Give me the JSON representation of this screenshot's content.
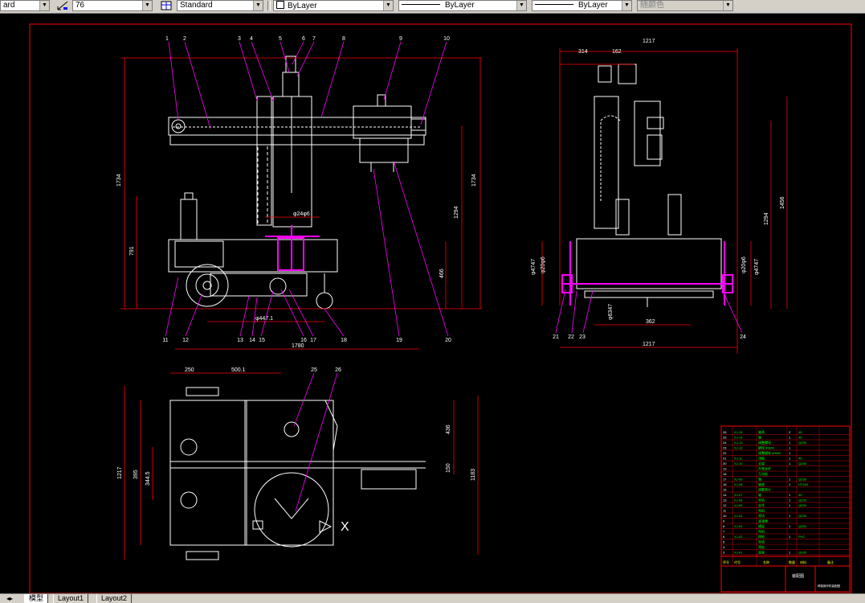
{
  "toolbar": {
    "text_style": "ard",
    "dim_scale": "76",
    "table_style": "Standard",
    "layer_color": "ByLayer",
    "linetype": "ByLayer",
    "lineweight": "ByLayer",
    "plot_style": "随颜色"
  },
  "tabs": {
    "nav": "◂▸",
    "model": "模型",
    "layout1": "Layout1",
    "layout2": "Layout2"
  },
  "colors": {
    "background": "#000000",
    "geometry": "#ffffff",
    "dimension": "#ff0000",
    "leader": "#ff00ff",
    "text_green": "#00ff00"
  },
  "drawing": {
    "front_view": {
      "callouts": [
        "1",
        "2",
        "3",
        "4",
        "5",
        "6",
        "7",
        "8",
        "9",
        "10",
        "11",
        "12",
        "13",
        "14",
        "15",
        "16",
        "17",
        "18",
        "19",
        "20"
      ],
      "dims": {
        "overall_width": "1780",
        "overall_height": "1734",
        "right_height_1": "1734",
        "right_height_2": "1294",
        "left_height": "791",
        "lower_height": "466",
        "diameter_top": "φ24φ6",
        "wheel_base": "φ447.1"
      }
    },
    "side_view": {
      "callouts": [
        "21",
        "22",
        "23",
        "24"
      ],
      "dims": {
        "top_width": "1217",
        "top_left": "314",
        "top_mid": "162",
        "right_height_1": "1456",
        "right_height_2": "1294",
        "left_dia_1": "φ4747",
        "left_dia_2": "φ20φ6",
        "right_dia_1": "φ20φ6",
        "right_dia_2": "φ4747",
        "bottom_mid": "362",
        "bottom_dia": "φ6347",
        "bottom_width": "1217"
      }
    },
    "top_view": {
      "callouts": [
        "25",
        "26"
      ],
      "dims": {
        "top_left": "250",
        "top_mid": "500.1",
        "left_height": "1217",
        "inner_left": "395",
        "inner_left2": "344.5",
        "right_1": "436",
        "right_2": "150",
        "right_3": "1183"
      }
    },
    "title_block": {
      "rows": [
        {
          "no": "26",
          "code": "XJ-15",
          "name": "轴承",
          "qty": "2",
          "mat": "45"
        },
        {
          "no": "25",
          "code": "XJ-14",
          "name": "轴",
          "qty": "1",
          "mat": "45"
        },
        {
          "no": "24",
          "code": "XJ-13",
          "name": "调整螺母",
          "qty": "1",
          "mat": "Q235"
        },
        {
          "no": "23",
          "code": "XJ-12",
          "name": "蜗轮 40MN",
          "qty": "1",
          "mat": ""
        },
        {
          "no": "22",
          "code": "",
          "name": "调整蜗轮 40MN",
          "qty": "1",
          "mat": ""
        },
        {
          "no": "21",
          "code": "XJ-11",
          "name": "顶板",
          "qty": "1",
          "mat": "45"
        },
        {
          "no": "20",
          "code": "XJ-10",
          "name": "支架",
          "qty": "1",
          "mat": "Q235"
        },
        {
          "no": "19",
          "code": "",
          "name": "升降丝杆",
          "qty": "",
          "mat": ""
        },
        {
          "no": "18",
          "code": "",
          "name": "万向轮",
          "qty": "",
          "mat": ""
        },
        {
          "no": "17",
          "code": "XJ-09",
          "name": "轴",
          "qty": "1",
          "mat": "Q235"
        },
        {
          "no": "16",
          "code": "XJ-08",
          "name": "轴座",
          "qty": "1",
          "mat": "HT150"
        },
        {
          "no": "15",
          "code": "",
          "name": "调整垫片",
          "qty": "",
          "mat": ""
        },
        {
          "no": "14",
          "code": "XJ-07",
          "name": "轴",
          "qty": "1",
          "mat": "45"
        },
        {
          "no": "13",
          "code": "XJ-06",
          "name": "导轨",
          "qty": "1",
          "mat": "Q235"
        },
        {
          "no": "12",
          "code": "XJ-05",
          "name": "支柱",
          "qty": "1",
          "mat": "Q235"
        },
        {
          "no": "11",
          "code": "",
          "name": "电机",
          "qty": "",
          "mat": ""
        },
        {
          "no": "10",
          "code": "XJ-04",
          "name": "滑块",
          "qty": "1",
          "mat": "Q235"
        },
        {
          "no": "9",
          "code": "",
          "name": "减速器",
          "qty": "",
          "mat": ""
        },
        {
          "no": "8",
          "code": "XJ-03",
          "name": "横梁",
          "qty": "1",
          "mat": "Q235"
        },
        {
          "no": "7",
          "code": "",
          "name": "电机",
          "qty": "",
          "mat": ""
        },
        {
          "no": "6",
          "code": "XJ-02",
          "name": "焊枪",
          "qty": "1",
          "mat": "PVC"
        },
        {
          "no": "5",
          "code": "",
          "name": "导线",
          "qty": "",
          "mat": ""
        },
        {
          "no": "4",
          "code": "",
          "name": "滑轮",
          "qty": "",
          "mat": ""
        },
        {
          "no": "3",
          "code": "XJ-01",
          "name": "底座",
          "qty": "1",
          "mat": "Q235"
        }
      ],
      "header": {
        "no": "序号",
        "code": "代号",
        "name": "名称",
        "qty": "数量",
        "mat": "材料",
        "note": "备注"
      },
      "title": "装配图",
      "drawing_name": "焊接操作机装配图"
    }
  }
}
